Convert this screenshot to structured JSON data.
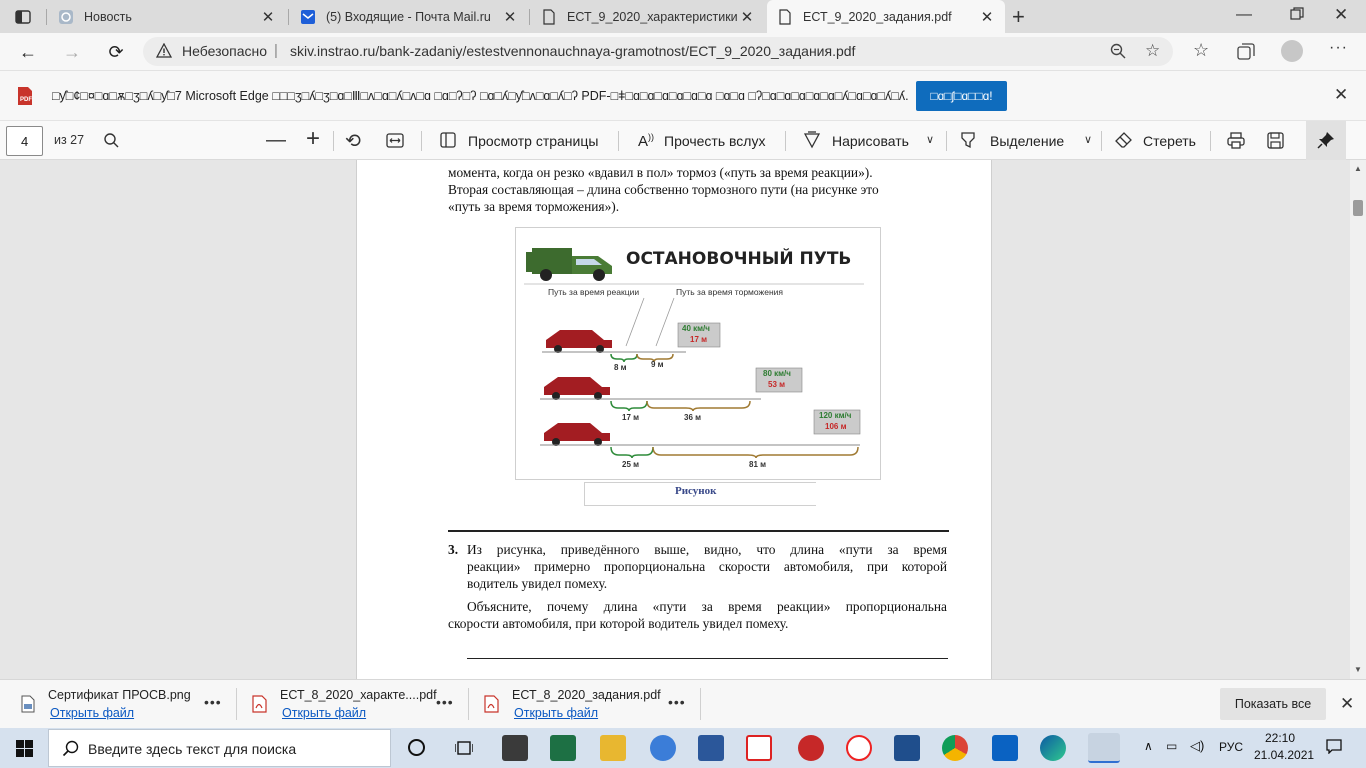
{
  "tabs": [
    {
      "title": "Новость",
      "active": false
    },
    {
      "title": "(5) Входящие - Почта Mail.ru",
      "active": false
    },
    {
      "title": "ЕСТ_9_2020_характеристики задан",
      "active": false
    },
    {
      "title": "ЕСТ_9_2020_задания.pdf",
      "active": true
    }
  ],
  "address": {
    "security": "Небезопасно",
    "separator": "|",
    "url": "skiv.instrao.ru/bank-zadaniy/estestvennonauchnaya-gramotnost/ЕСТ_9_2020_задания.pdf"
  },
  "infobar": {
    "message": "□ƴ□¢□¤□ɑ□ѫ□ʒ□ʎ□ƴ□7 Microsoft Edge □□□ʒ□ʎ□ʒ□ɑ□Ⅲ□ʌ□ɑ□ʎ□ʌ□ɑ □ɑ□ʔ□ʔ □ɑ□ʎ□ƴ□ʌ□ɑ□ʎ□ʔ PDF-□ǂ□ɑ□ɑ□ɑ□ɑ□ɑ□ɑ □ɑ□ɑ □ʔ□ɑ□ɑ□ɑ□ɑ□ɑ□ʎ□ɑ□ɑ□ʎ□ʎ.",
    "button": "□ɑ□ʃ□ɑ□□ɑ!"
  },
  "pdf_toolbar": {
    "page_number": "4",
    "page_count": "из 27",
    "page_view": "Просмотр страницы",
    "read_aloud": "Прочесть вслух",
    "draw": "Нарисовать",
    "highlight": "Выделение",
    "erase": "Стереть"
  },
  "document": {
    "intro_line1": "момента, когда он резко «вдавил в пол» тормоз («путь за время реакции»).",
    "intro_line2": "Вторая составляющая – длина собственно тормозного пути (на рисунке это",
    "intro_line3": "«путь за время торможения»).",
    "figure": {
      "title": "ОСТАНОВОЧНЫЙ ПУТЬ",
      "label_reaction": "Путь за время реакции",
      "label_braking": "Путь за время торможения",
      "rows": [
        {
          "speed": "40 км/ч",
          "total": "17 м",
          "reaction": "8 м",
          "braking": "9 м"
        },
        {
          "speed": "80 км/ч",
          "total": "53 м",
          "reaction": "17 м",
          "braking": "36 м"
        },
        {
          "speed": "120 км/ч",
          "total": "106 м",
          "reaction": "25 м",
          "braking": "81 м"
        }
      ],
      "caption": "Рисунок"
    },
    "q3_number": "3.",
    "q3_line1": "Из рисунка, приведённого выше, видно, что длина «пути за время",
    "q3_line2": "реакции» примерно пропорциональна скорости автомобиля, при которой",
    "q3_line3": "водитель увидел помеху.",
    "q3_explain1": "Объясните, почему длина «пути за время реакции» пропорциональна",
    "q3_explain2": "скорости автомобиля, при которой водитель увидел помеху."
  },
  "downloads": {
    "items": [
      {
        "name": "Сертификат ПРОСВ.png",
        "link": "Открыть файл"
      },
      {
        "name": "ЕСТ_8_2020_характе....pdf",
        "link": "Открыть файл"
      },
      {
        "name": "ЕСТ_8_2020_задания.pdf",
        "link": "Открыть файл"
      }
    ],
    "more": "•••",
    "show_all": "Показать все"
  },
  "taskbar": {
    "search_placeholder": "Введите здесь текст для поиска",
    "lang": "РУС",
    "time": "22:10",
    "date": "21.04.2021"
  },
  "colors": {
    "accent": "#0f6cbd",
    "car": "#a31d22",
    "green": "#2e8b3a",
    "brown": "#a07a32"
  }
}
